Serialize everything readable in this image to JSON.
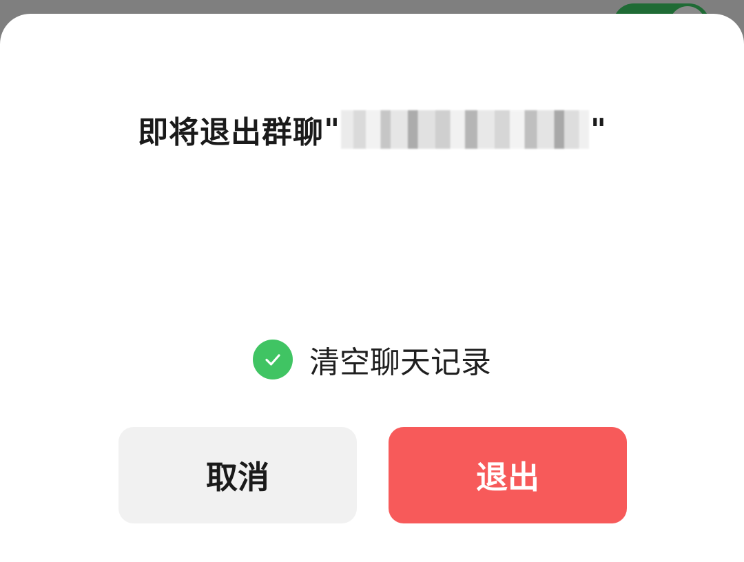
{
  "dialog": {
    "title_prefix": "即将退出群聊",
    "title_open_quote": "\"",
    "title_close_quote": "\"",
    "clear_history_label": "清空聊天记录",
    "clear_history_checked": true,
    "cancel_label": "取消",
    "exit_label": "退出"
  },
  "colors": {
    "check_green": "#40c463",
    "exit_red": "#f75a5a",
    "cancel_gray": "#f1f1f1"
  },
  "icons": {
    "check": "checkmark-circle-icon",
    "background_toggle": "toggle-switch"
  }
}
